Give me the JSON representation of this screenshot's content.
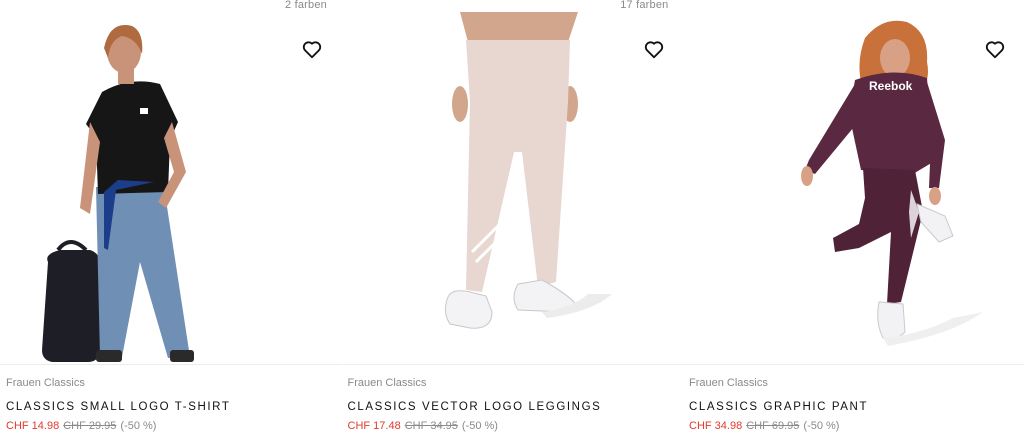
{
  "products": [
    {
      "colors": "2 farben",
      "category": "Frauen Classics",
      "name": "CLASSICS SMALL LOGO T-SHIRT",
      "price": "CHF 14.98",
      "old_price": "CHF 29.95",
      "discount": "(-50 %)",
      "image_desc": "woman-black-tshirt-jeans-backpack"
    },
    {
      "colors": "17 farben",
      "category": "Frauen Classics",
      "name": "CLASSICS VECTOR LOGO LEGGINGS",
      "price": "CHF 17.48",
      "old_price": "CHF 34.95",
      "discount": "(-50 %)",
      "image_desc": "pink-leggings-white-sneakers"
    },
    {
      "colors": "",
      "category": "Frauen Classics",
      "name": "CLASSICS GRAPHIC PANT",
      "price": "CHF 34.98",
      "old_price": "CHF 69.95",
      "discount": "(-50 %)",
      "image_desc": "woman-burgundy-sweatshirt-joggers",
      "print_text": "Reebok"
    }
  ],
  "colors": {
    "sale": "#e03a2f",
    "muted": "#8a8a8a",
    "leggings": "#e8d6d0",
    "burgundy": "#5a2840",
    "denim": "#6f8fb5",
    "tshirt": "#161616"
  },
  "icons": [
    "heart-icon"
  ]
}
